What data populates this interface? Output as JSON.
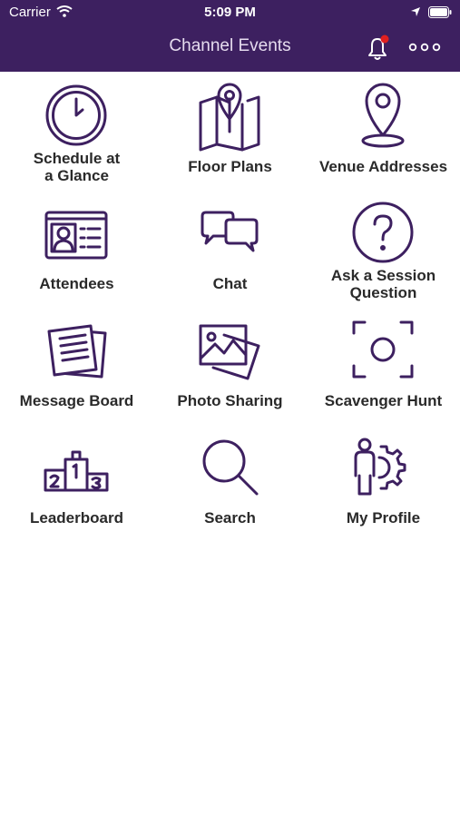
{
  "status_bar": {
    "carrier": "Carrier",
    "time": "5:09 PM"
  },
  "nav": {
    "title": "Channel Events",
    "bell_icon": "bell-icon",
    "notification_dot_color": "#e02020",
    "more_icon": "more-dots-icon"
  },
  "colors": {
    "brand": "#3d2060",
    "icon_stroke": "#3d2060",
    "label": "#2a2a2a"
  },
  "tiles": [
    {
      "label_line1": "Schedule at",
      "label_line2": "a Glance",
      "icon": "clock-icon"
    },
    {
      "label_line1": "Floor Plans",
      "label_line2": "",
      "icon": "map-icon"
    },
    {
      "label_line1": "Venue Addresses",
      "label_line2": "",
      "icon": "location-pin-icon"
    },
    {
      "label_line1": "Attendees",
      "label_line2": "",
      "icon": "id-card-icon"
    },
    {
      "label_line1": "Chat",
      "label_line2": "",
      "icon": "chat-bubbles-icon"
    },
    {
      "label_line1": "Ask a Session",
      "label_line2": "Question",
      "icon": "question-icon"
    },
    {
      "label_line1": "Message Board",
      "label_line2": "",
      "icon": "notes-icon"
    },
    {
      "label_line1": "Photo Sharing",
      "label_line2": "",
      "icon": "photos-icon"
    },
    {
      "label_line1": "Scavenger Hunt",
      "label_line2": "",
      "icon": "scan-target-icon"
    },
    {
      "label_line1": "Leaderboard",
      "label_line2": "",
      "icon": "podium-icon"
    },
    {
      "label_line1": "Search",
      "label_line2": "",
      "icon": "search-icon"
    },
    {
      "label_line1": "My Profile",
      "label_line2": "",
      "icon": "profile-gear-icon"
    }
  ]
}
